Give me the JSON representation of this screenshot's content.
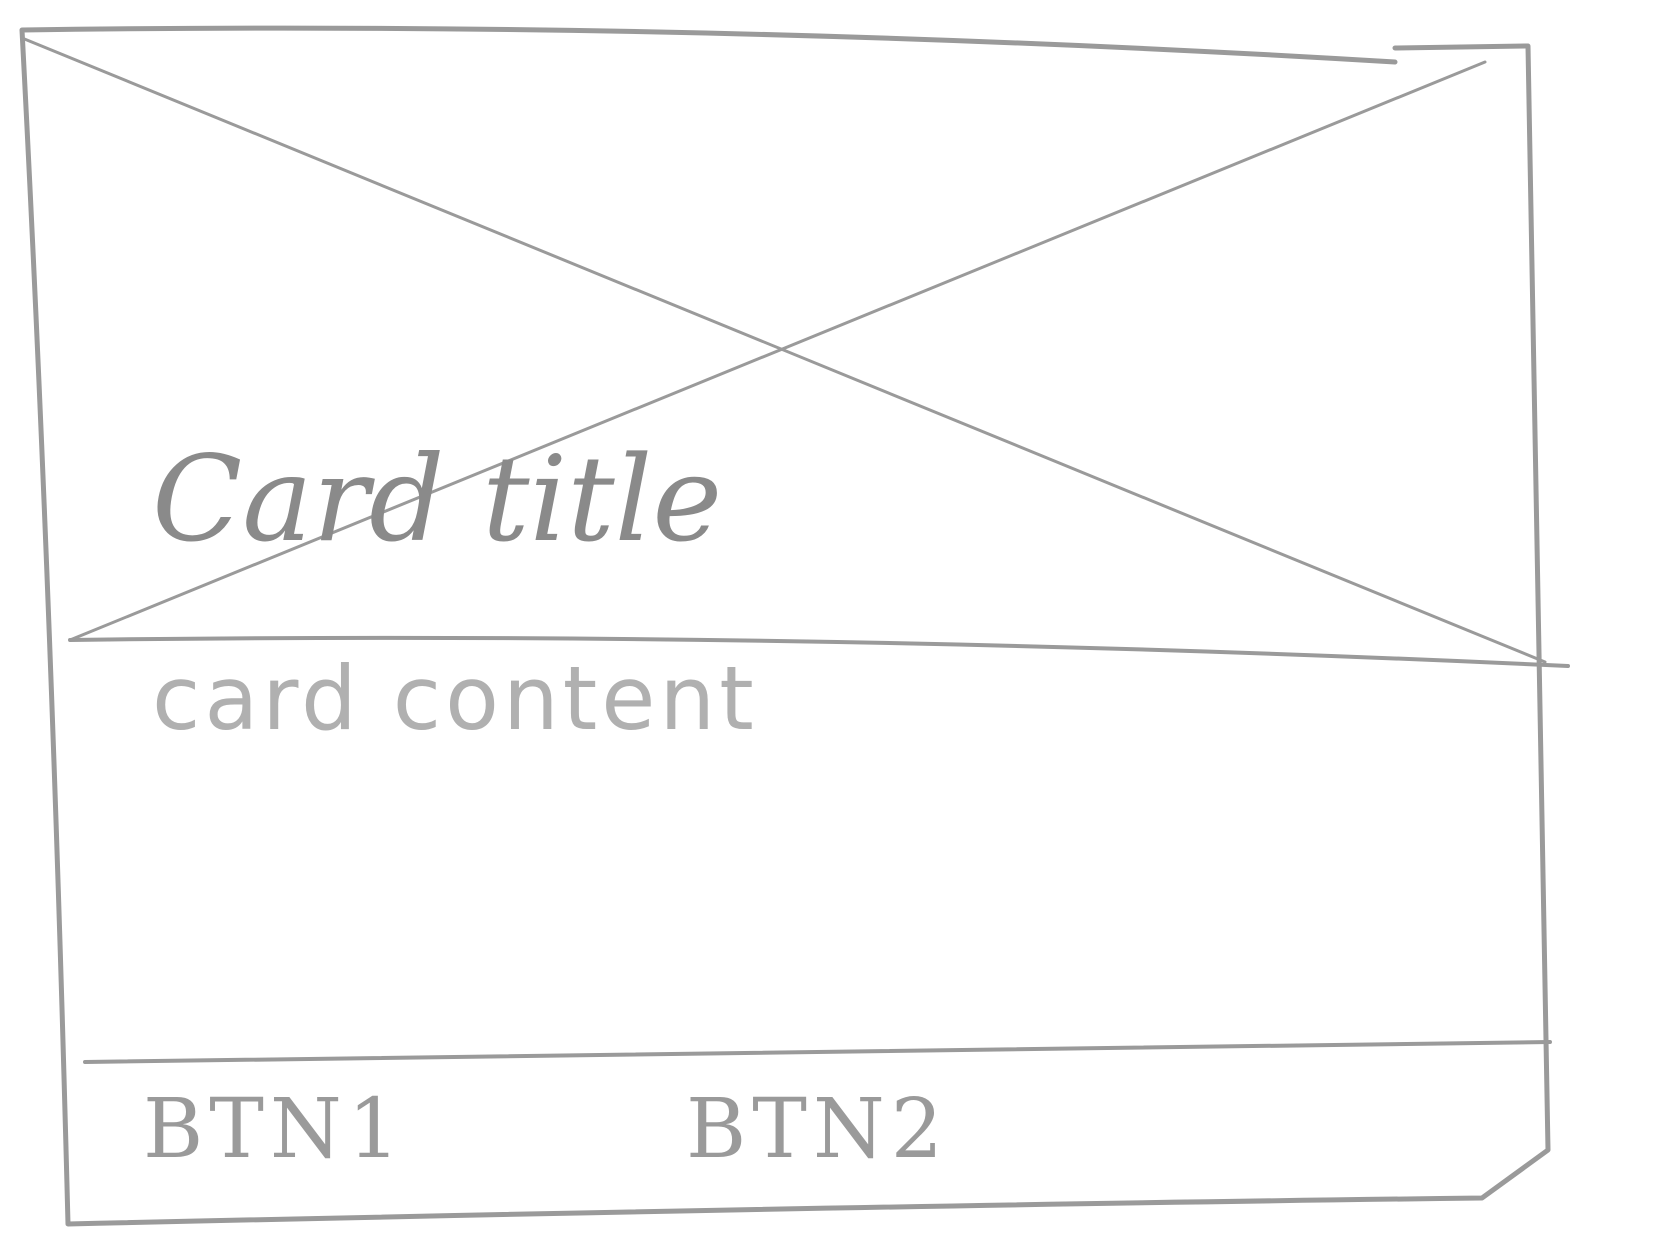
{
  "card": {
    "image_placeholder_icon": "crossed-box-image-placeholder",
    "title": "Card title",
    "content": "card content",
    "actions": [
      {
        "label": "BTN1"
      },
      {
        "label": "BTN2"
      }
    ]
  },
  "colors": {
    "pencil_stroke": "#9a9a9a",
    "paper": "#ffffff"
  }
}
